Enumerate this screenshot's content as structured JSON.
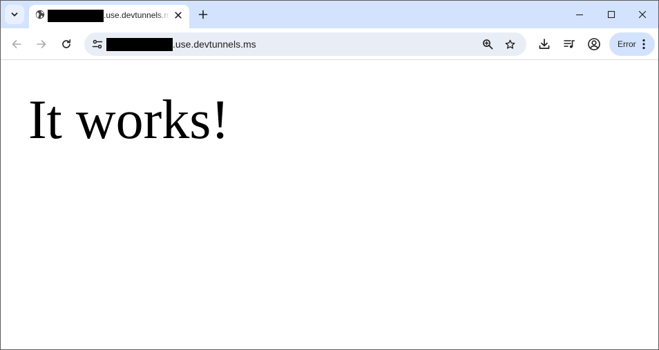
{
  "browser": {
    "tab": {
      "title": ".use.devtunnels.ms"
    },
    "address_bar": {
      "url": ".use.devtunnels.ms"
    },
    "profile_status": {
      "label": "Error"
    },
    "icons": {
      "tab_search": "chevron-down-icon",
      "favicon": "globe-icon",
      "tab_close": "close-icon",
      "new_tab": "plus-icon",
      "back": "arrow-left-icon",
      "forward": "arrow-right-icon",
      "reload": "reload-icon",
      "site_info": "tune-icon",
      "zoom": "zoom-in-icon",
      "bookmark": "star-icon",
      "downloads": "download-icon",
      "media": "media-queue-icon",
      "profile": "account-circle-icon",
      "menu": "more-vert-icon",
      "minimize": "minimize-icon",
      "maximize": "maximize-icon",
      "close_window": "close-icon"
    },
    "colors": {
      "titlebar": "#d3e3fd",
      "omnibox": "#e9eef6",
      "error_pill": "#d3e3fd"
    }
  },
  "page": {
    "heading": "It works!"
  }
}
